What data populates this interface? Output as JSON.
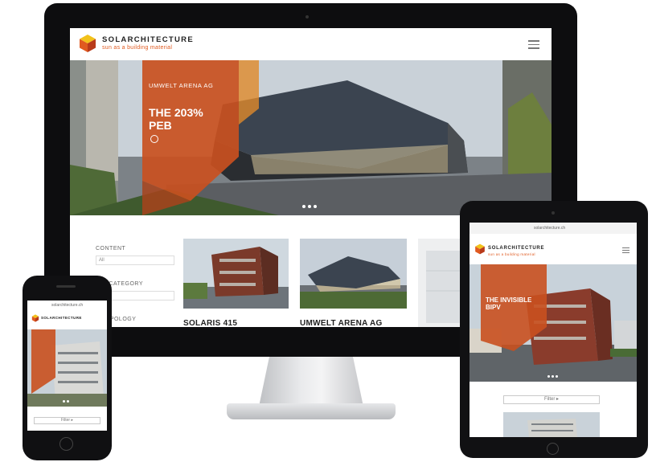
{
  "site": {
    "brand": "SOLARCHITECTURE",
    "tagline": "sun as a building material"
  },
  "desktop": {
    "hero": {
      "subtitle": "UMWELT ARENA AG",
      "title_line1": "THE 203%",
      "title_line2": "PEB"
    },
    "filters": [
      {
        "label": "CONTENT",
        "value": "All"
      },
      {
        "label": "ING CATEGORY",
        "value": ""
      },
      {
        "label": "N TYPOLOGY",
        "value": ""
      }
    ],
    "cards": [
      {
        "title": "SOLARIS 415"
      },
      {
        "title": "UMWELT ARENA AG"
      }
    ]
  },
  "tablet": {
    "url": "solarchitecture.ch",
    "hero_title_line1": "THE INVISIBLE",
    "hero_title_line2": "BIPV",
    "filter_button": "Filter ▸"
  },
  "phone": {
    "url": "solarchitecture.ch",
    "filter_button": "Filter ▸"
  },
  "colors": {
    "accent_orange": "#e05a20",
    "hero_orange": "#c9501f",
    "device_black": "#0d0d0f"
  }
}
